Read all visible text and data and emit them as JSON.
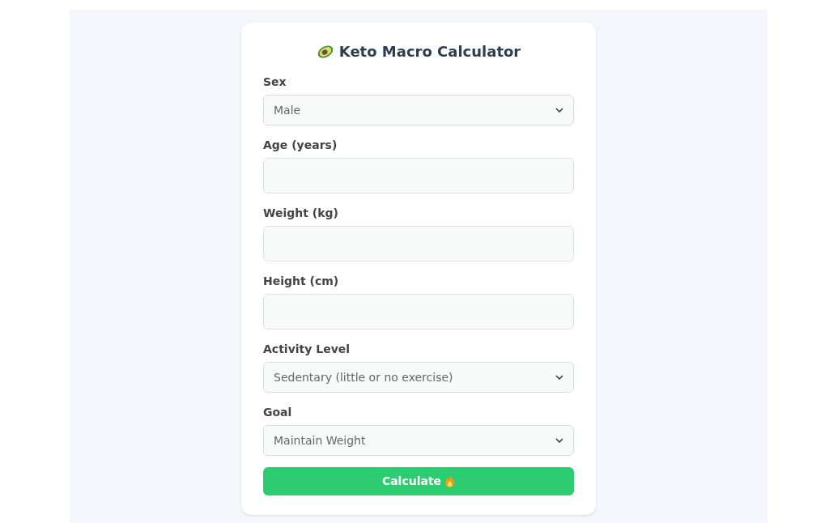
{
  "title": "Keto Macro Calculator",
  "fields": [
    {
      "label": "Sex",
      "kind": "select",
      "value": "Male"
    },
    {
      "label": "Age (years)",
      "kind": "input"
    },
    {
      "label": "Weight (kg)",
      "kind": "input"
    },
    {
      "label": "Height (cm)",
      "kind": "input"
    },
    {
      "label": "Activity Level",
      "kind": "select",
      "value": "Sedentary (little or no exercise)"
    },
    {
      "label": "Goal",
      "kind": "select",
      "value": "Maintain Weight"
    }
  ],
  "button": "Calculate"
}
